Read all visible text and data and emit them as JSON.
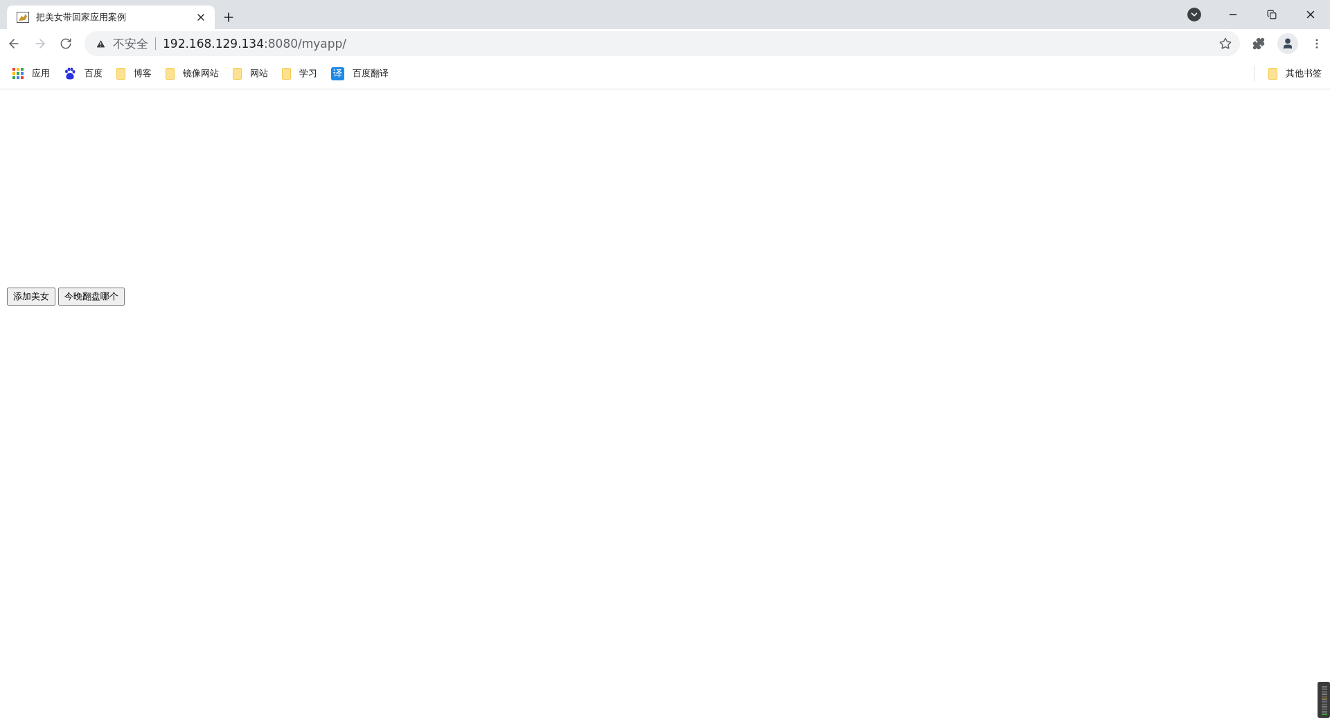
{
  "tab": {
    "title": "把美女带回家应用案例",
    "selected": true
  },
  "address": {
    "security_label": "不安全",
    "host": "192.168.129.134",
    "path": ":8080/myapp/"
  },
  "bookmarks": [
    {
      "label": "应用",
      "kind": "apps"
    },
    {
      "label": "百度",
      "kind": "paw"
    },
    {
      "label": "博客",
      "kind": "folder"
    },
    {
      "label": "镜像网站",
      "kind": "folder"
    },
    {
      "label": "网站",
      "kind": "folder"
    },
    {
      "label": "学习",
      "kind": "folder"
    },
    {
      "label": "百度翻译",
      "kind": "translate",
      "glyph": "译"
    }
  ],
  "other_bookmarks": {
    "label": "其他书签",
    "kind": "folder"
  },
  "buttons": [
    "添加美女",
    "今晚翻盘哪个"
  ]
}
